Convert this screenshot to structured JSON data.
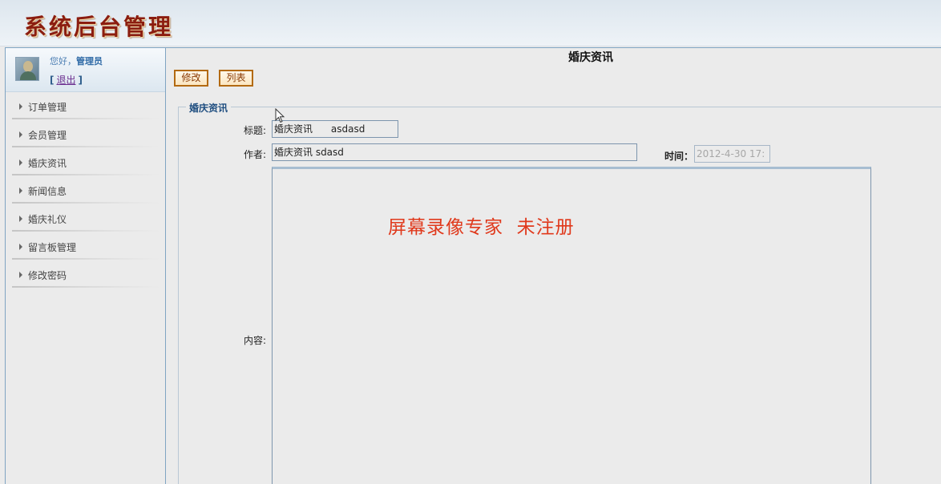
{
  "header": {
    "title": "系统后台管理"
  },
  "user": {
    "greeting": "您好，",
    "name": "管理员",
    "bracket_open": "[",
    "logout": "退出",
    "bracket_close": "]"
  },
  "sidebar": {
    "items": [
      {
        "label": "订单管理"
      },
      {
        "label": "会员管理"
      },
      {
        "label": "婚庆资讯"
      },
      {
        "label": "新闻信息"
      },
      {
        "label": "婚庆礼仪"
      },
      {
        "label": "留言板管理"
      },
      {
        "label": "修改密码"
      }
    ]
  },
  "main": {
    "title": "婚庆资讯",
    "buttons": {
      "edit": "修改",
      "list": "列表"
    },
    "form": {
      "legend": "婚庆资讯",
      "title_label": "标题:",
      "title_value": "婚庆资讯      asdasd",
      "author_label": "作者:",
      "author_value": "婚庆资讯 sdasd",
      "time_label": "时间：",
      "time_value": "2012-4-30 17:",
      "content_label": "内容:"
    }
  },
  "watermark": "屏幕录像专家  未注册",
  "colors": {
    "header_title": "#8b1d10",
    "button_border": "#b36a12",
    "legend": "#1f4e80",
    "watermark": "#e0391c"
  }
}
